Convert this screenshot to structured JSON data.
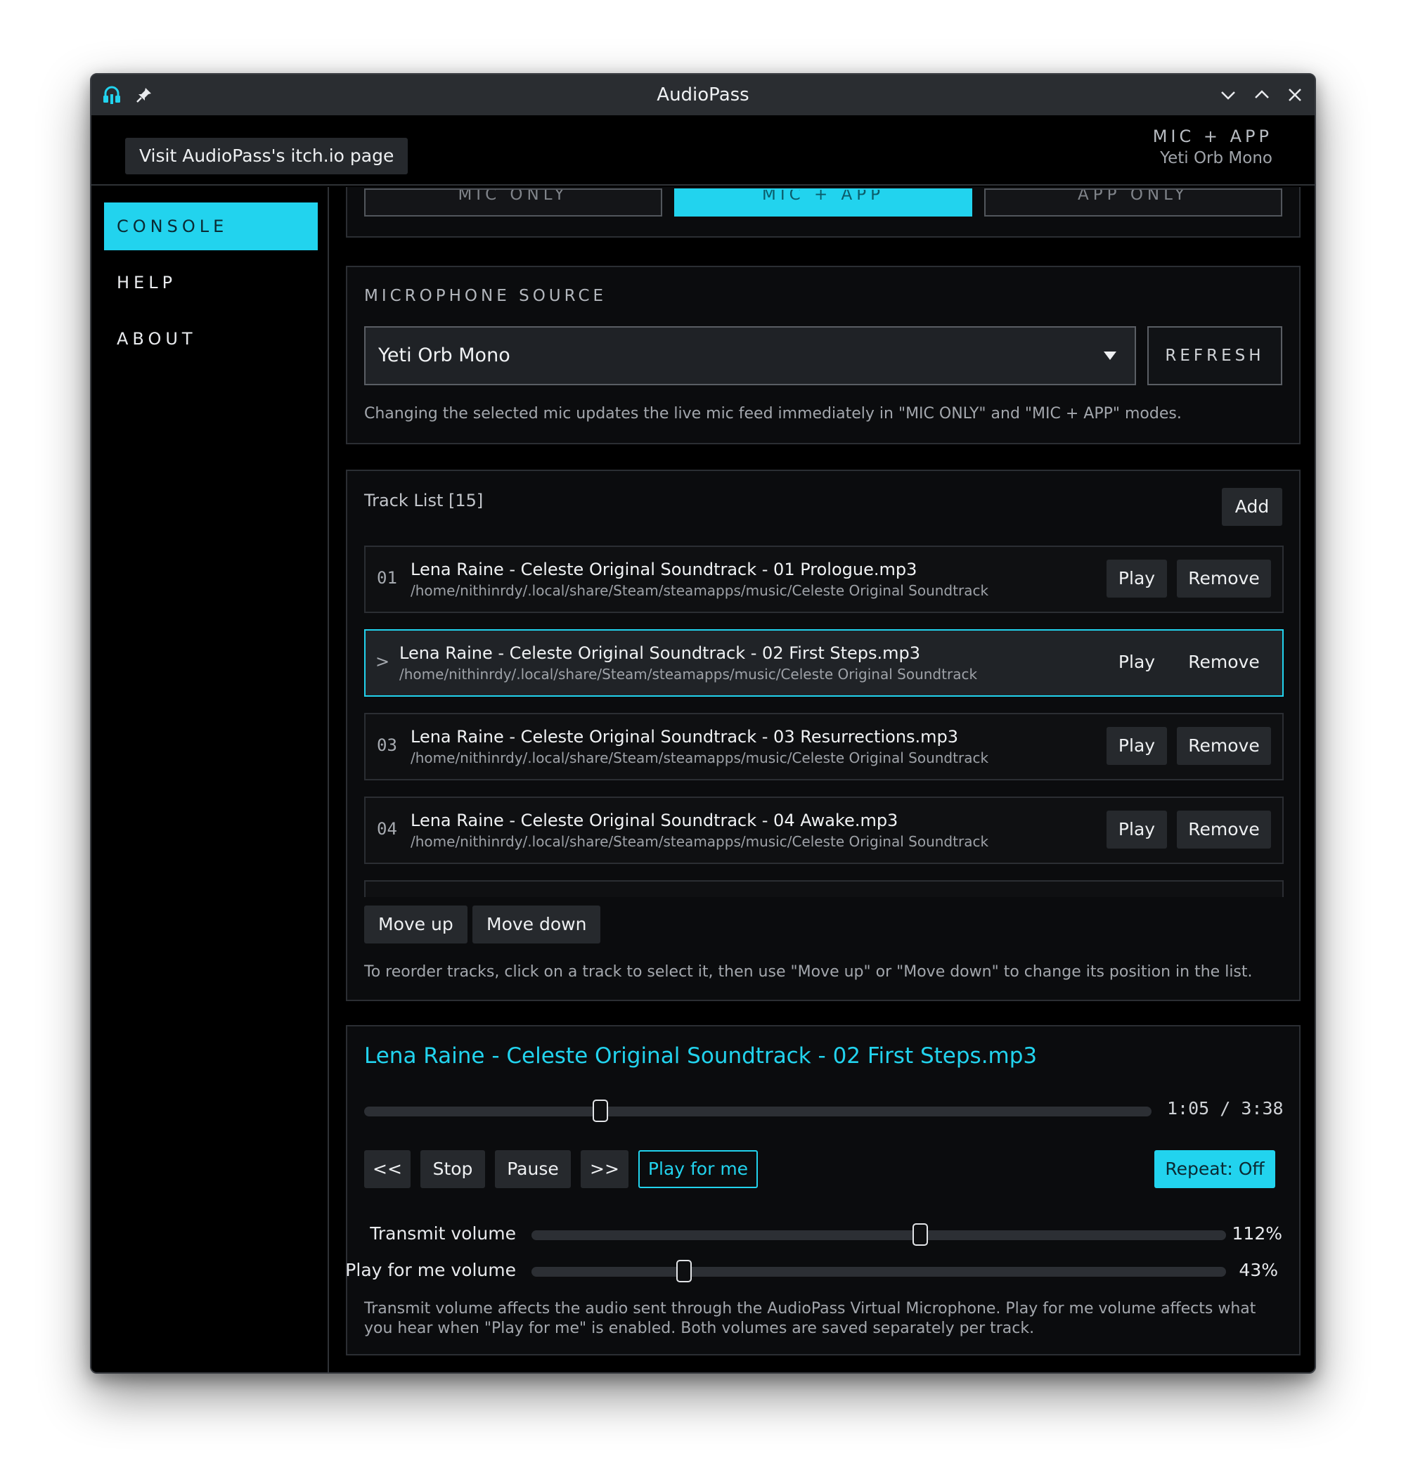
{
  "window": {
    "title": "AudioPass",
    "icons": {
      "app": "headphones-icon",
      "pin": "pin-icon",
      "minimize": "chevron-down-icon",
      "maximize": "chevron-up-icon",
      "close": "close-icon"
    }
  },
  "header": {
    "itch_button": "Visit AudioPass's itch.io page",
    "mode": "MIC + APP",
    "device": "Yeti Orb Mono"
  },
  "sidebar": {
    "items": [
      {
        "label": "CONSOLE",
        "active": true
      },
      {
        "label": "HELP",
        "active": false
      },
      {
        "label": "ABOUT",
        "active": false
      }
    ]
  },
  "modes": {
    "buttons": [
      {
        "label": "MIC ONLY",
        "active": false
      },
      {
        "label": "MIC + APP",
        "active": true
      },
      {
        "label": "APP ONLY",
        "active": false
      }
    ]
  },
  "mic": {
    "section_label": "MICROPHONE SOURCE",
    "selected": "Yeti Orb Mono",
    "refresh_label": "REFRESH",
    "hint": "Changing the selected mic updates the live mic feed immediately in \"MIC ONLY\" and \"MIC + APP\" modes."
  },
  "tracks": {
    "title": "Track List [15]",
    "add_label": "Add",
    "play_label": "Play",
    "remove_label": "Remove",
    "selected_marker": ">",
    "items": [
      {
        "num": "01",
        "name": "Lena Raine - Celeste Original Soundtrack - 01 Prologue.mp3",
        "path": "/home/nithinrdy/.local/share/Steam/steamapps/music/Celeste Original Soundtrack",
        "selected": false
      },
      {
        "num": "02",
        "name": "Lena Raine - Celeste Original Soundtrack - 02 First Steps.mp3",
        "path": "/home/nithinrdy/.local/share/Steam/steamapps/music/Celeste Original Soundtrack",
        "selected": true
      },
      {
        "num": "03",
        "name": "Lena Raine - Celeste Original Soundtrack - 03 Resurrections.mp3",
        "path": "/home/nithinrdy/.local/share/Steam/steamapps/music/Celeste Original Soundtrack",
        "selected": false
      },
      {
        "num": "04",
        "name": "Lena Raine - Celeste Original Soundtrack - 04 Awake.mp3",
        "path": "/home/nithinrdy/.local/share/Steam/steamapps/music/Celeste Original Soundtrack",
        "selected": false
      }
    ],
    "move_up_label": "Move up",
    "move_down_label": "Move down",
    "hint": "To reorder tracks, click on a track to select it, then use \"Move up\" or \"Move down\" to change its position in the list."
  },
  "player": {
    "now_playing": "Lena Raine - Celeste Original Soundtrack - 02 First Steps.mp3",
    "position_fraction": 0.3,
    "time": "1:05 / 3:38",
    "controls": {
      "prev": "<<",
      "stop": "Stop",
      "pause": "Pause",
      "next": ">>",
      "play_for_me": "Play for me",
      "repeat": "Repeat: Off"
    },
    "transmit_label": "Transmit volume",
    "transmit_value": "112%",
    "transmit_fraction": 0.56,
    "play_for_me_label": "Play for me volume",
    "play_for_me_value": "43%",
    "play_for_me_fraction": 0.22,
    "hint": "Transmit volume affects the audio sent through the AudioPass Virtual Microphone. Play for me volume affects what you hear when \"Play for me\" is enabled. Both volumes are saved separately per track."
  },
  "colors": {
    "accent": "#22d3ee",
    "background": "#000000",
    "button": "#26292d",
    "titlebar": "#2a2d31"
  }
}
